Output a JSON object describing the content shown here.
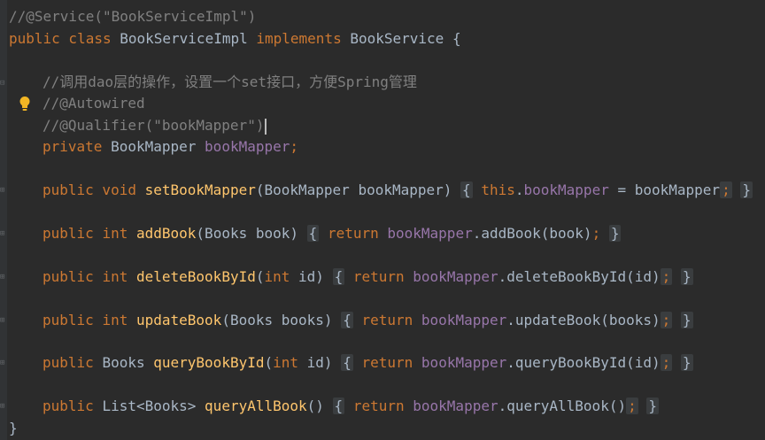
{
  "code": {
    "l1": "//@Service(\"BookServiceImpl\")",
    "l2_kw": "public class",
    "l2_name": "BookServiceImpl",
    "l2_impl": "implements",
    "l2_iface": "BookService {",
    "l3_comment": "//调用dao层的操作，设置一个set接口，方便Spring管理",
    "l4_comment": "//@Autowired",
    "l5_comment": "//@Qualifier(\"bookMapper\")",
    "l6_kw": "private",
    "l6_type": "BookMapper",
    "l6_field": "bookMapper",
    "semi": ";",
    "set": {
      "kw": "public void",
      "name": "setBookMapper",
      "params": "(BookMapper bookMapper)",
      "open": "{",
      "this": "this",
      "dot": ".",
      "field": "bookMapper",
      "rest": " = bookMapper",
      "semi": ";",
      "close": "}"
    },
    "add": {
      "kw1": "public",
      "kw2": "int",
      "name": "addBook",
      "params": "(Books book)",
      "open": "{",
      "ret": "return",
      "field": "bookMapper",
      "call": ".addBook(book)",
      "semi": ";",
      "close": "}"
    },
    "del": {
      "kw1": "public",
      "kw2": "int",
      "name": "deleteBookById",
      "p1": "(",
      "pkw": "int",
      "p2": " id)",
      "open": "{",
      "ret": "return",
      "field": "bookMapper",
      "call": ".deleteBookById(id)",
      "semi": ";",
      "close": "}"
    },
    "upd": {
      "kw1": "public",
      "kw2": "int",
      "name": "updateBook",
      "params": "(Books books)",
      "open": "{",
      "ret": "return",
      "field": "bookMapper",
      "call": ".updateBook(books)",
      "semi": ";",
      "close": "}"
    },
    "query": {
      "kw1": "public",
      "type": "Books",
      "name": "queryBookById",
      "p1": "(",
      "pkw": "int",
      "p2": " id)",
      "open": "{",
      "ret": "return",
      "field": "bookMapper",
      "call": ".queryBookById(id)",
      "semi": ";",
      "close": "}"
    },
    "all": {
      "kw1": "public",
      "type": "List<Books>",
      "name": "queryAllBook",
      "params": "()",
      "open": "{",
      "ret": "return",
      "field": "bookMapper",
      "call": ".queryAllBook()",
      "semi": ";",
      "close": "}"
    },
    "end": "}"
  },
  "colors": {
    "background": "#2b2b2b",
    "keyword": "#cc7832",
    "comment": "#808080",
    "method": "#ffc66d",
    "field": "#9876aa",
    "text": "#a9b7c6"
  },
  "icons": {
    "intention": "lightbulb-icon",
    "fold": "fold-marker-icon"
  }
}
